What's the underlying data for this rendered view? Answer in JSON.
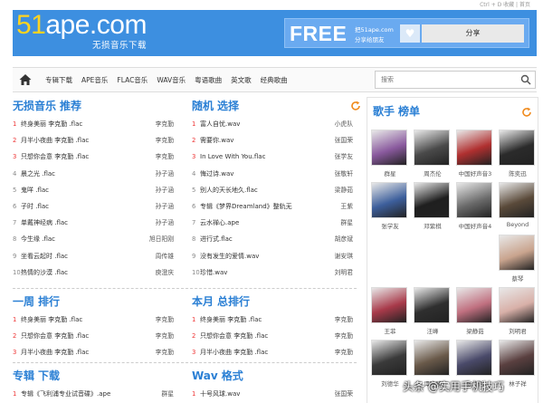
{
  "topbar": {
    "links": "Ctrl + D 收藏 | 首页"
  },
  "header": {
    "logo_accent": "51",
    "logo_rest": "ape.com",
    "slogan": "无损音乐下载",
    "free": "FREE",
    "share_line1": "把51ape.com",
    "share_line2": "分享给朋友",
    "share_button": "分享"
  },
  "nav": {
    "items": [
      "专辑下载",
      "APE音乐",
      "FLAC音乐",
      "WAV音乐",
      "粤语歌曲",
      "英文歌",
      "经典歌曲"
    ],
    "search_placeholder": "搜索"
  },
  "sections": {
    "lossless": {
      "title": "无损音乐",
      "sub": "推荐",
      "items": [
        {
          "n": "1",
          "song": "终身美丽 李克勤 .flac",
          "artist": "李克勤"
        },
        {
          "n": "2",
          "song": "月半小夜曲 李克勤 .flac",
          "artist": "李克勤"
        },
        {
          "n": "3",
          "song": "只想你会意 李克勤 .flac",
          "artist": "李克勤"
        },
        {
          "n": "4",
          "song": "晨之光 .flac",
          "artist": "孙子涵"
        },
        {
          "n": "5",
          "song": "鬼咩 .flac",
          "artist": "孙子涵"
        },
        {
          "n": "6",
          "song": "子时 .flac",
          "artist": "孙子涵"
        },
        {
          "n": "7",
          "song": "单戴神经病 .flac",
          "artist": "孙子涵"
        },
        {
          "n": "8",
          "song": "今生缘 .flac",
          "artist": "旭日阳刚"
        },
        {
          "n": "9",
          "song": "坐看云起时 .flac",
          "artist": "周传雄"
        },
        {
          "n": "10",
          "song": "热情的沙漠 .flac",
          "artist": "庾澄庆"
        }
      ]
    },
    "random": {
      "title": "随机",
      "sub": "选择",
      "items": [
        {
          "n": "1",
          "song": "富人自忧.wav",
          "artist": "小虎队"
        },
        {
          "n": "2",
          "song": "需要你.wav",
          "artist": "张国荣"
        },
        {
          "n": "3",
          "song": "In Love With You.flac",
          "artist": "张学友"
        },
        {
          "n": "4",
          "song": "悔过诗.wav",
          "artist": "张敬轩"
        },
        {
          "n": "5",
          "song": "别人的天长地久.flac",
          "artist": "梁静茹"
        },
        {
          "n": "6",
          "song": "专辑《梦界Dreamland》整轨无",
          "artist": "王紫"
        },
        {
          "n": "7",
          "song": "云水禅心.ape",
          "artist": "群星"
        },
        {
          "n": "8",
          "song": "进行式.flac",
          "artist": "胡彦斌"
        },
        {
          "n": "9",
          "song": "没有发生的爱情.wav",
          "artist": "谢安琪"
        },
        {
          "n": "10",
          "song": "珍惜.wav",
          "artist": "刘明君"
        }
      ]
    },
    "week": {
      "title": "一周",
      "sub": "排行",
      "items": [
        {
          "n": "1",
          "song": "终身美丽 李克勤 .flac",
          "artist": "李克勤"
        },
        {
          "n": "2",
          "song": "只想你会意 李克勤 .flac",
          "artist": "李克勤"
        },
        {
          "n": "3",
          "song": "月半小夜曲 李克勤 .flac",
          "artist": "李克勤"
        }
      ]
    },
    "month": {
      "title": "本月",
      "sub": "总排行",
      "items": [
        {
          "n": "1",
          "song": "终身美丽 李克勤 .flac",
          "artist": "李克勤"
        },
        {
          "n": "2",
          "song": "只想你会意 李克勤 .flac",
          "artist": "李克勤"
        },
        {
          "n": "3",
          "song": "月半小夜曲 李克勤 .flac",
          "artist": "李克勤"
        }
      ]
    },
    "album": {
      "title": "专辑",
      "sub": "下载",
      "items": [
        {
          "n": "1",
          "song": "专辑《飞利浦专业试音碟》.ape",
          "artist": "群星"
        }
      ]
    },
    "wav": {
      "title": "Wav",
      "sub": "格式",
      "items": [
        {
          "n": "1",
          "song": "十号风球.wav",
          "artist": "张国荣"
        }
      ]
    }
  },
  "singers": {
    "title": "歌手",
    "sub": "榜单",
    "list": [
      {
        "name": "群星",
        "color": "#8a5a9e"
      },
      {
        "name": "周杰伦",
        "color": "#4a4a4a"
      },
      {
        "name": "中国好声音3",
        "color": "#b03030"
      },
      {
        "name": "陈奕迅",
        "color": "#2b2b2b"
      },
      {
        "name": "张学友",
        "color": "#3d5f9c"
      },
      {
        "name": "邓紫棋",
        "color": "#1f1f1f"
      },
      {
        "name": "中国好声音4",
        "color": "#6b6b6b"
      },
      {
        "name": "Beyond",
        "color": "#5a4a3a"
      },
      {
        "name": "蔡琴",
        "color": "#c9a48e"
      },
      {
        "name": "王菲",
        "color": "#a83a4a"
      },
      {
        "name": "汪峰",
        "color": "#2f2f2f"
      },
      {
        "name": "梁静茹",
        "color": "#c07080"
      },
      {
        "name": "刘明君",
        "color": "#d8b0a8"
      },
      {
        "name": "刘德华",
        "color": "#3a3a3a"
      },
      {
        "name": "谭咏麟",
        "color": "#6a5a4a"
      },
      {
        "name": "张信哲",
        "color": "#4a4a6a"
      },
      {
        "name": "林子祥",
        "color": "#5a4040"
      }
    ]
  },
  "watermark": "头条 @实用手机技巧",
  "colors": {
    "brand_blue": "#3d8fe0",
    "logo_accent": "#ffd321",
    "section_title": "#2a7fd4",
    "hot_rank": "#e33333",
    "refresh_orange": "#f08a1c"
  }
}
